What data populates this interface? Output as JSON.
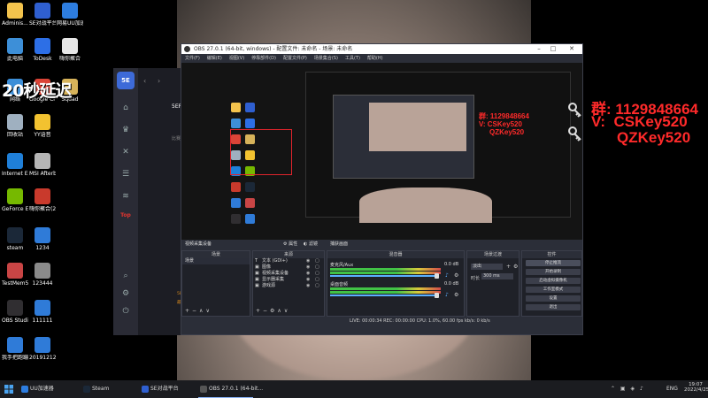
{
  "desktop_icons": [
    {
      "label": "Adminis...",
      "color": "#f3c34d"
    },
    {
      "label": "SE对战平台",
      "color": "#2f5fd0"
    },
    {
      "label": "网易UU加速器",
      "color": "#2d7de0"
    },
    {
      "label": "此电脑",
      "color": "#3d8fd8"
    },
    {
      "label": "ToDesk",
      "color": "#2d6fe6"
    },
    {
      "label": "嗨你聚合",
      "color": "#e7e7e7"
    },
    {
      "label": "网络",
      "color": "#3d8fd8"
    },
    {
      "label": "Google Chrome",
      "color": "#db4437"
    },
    {
      "label": "Squad",
      "color": "#d7b35a"
    },
    {
      "label": "回收站",
      "color": "#9fb0c0"
    },
    {
      "label": "YY语音",
      "color": "#f2c230"
    },
    {
      "label": "Internet Explorer",
      "color": "#1f7fd8"
    },
    {
      "label": "MSI Afterburner",
      "color": "#b5b5b5"
    },
    {
      "label": "GeForce Experience",
      "color": "#76b900"
    },
    {
      "label": "嗨你聚合(2)",
      "color": "#c93a2c"
    },
    {
      "label": "steam",
      "color": "#1b2838"
    },
    {
      "label": "1234",
      "color": "#2f7bd8"
    },
    {
      "label": "TestMem5",
      "color": "#c94545"
    },
    {
      "label": "123444",
      "color": "#8a8a8a"
    },
    {
      "label": "OBS Studio",
      "color": "#302e31"
    },
    {
      "label": "111111",
      "color": "#2f7bd8"
    },
    {
      "label": "我手把跑蹦得主播",
      "color": "#2f7bd8"
    },
    {
      "label": "20191212...",
      "color": "#2f7bd8"
    }
  ],
  "launcher": {
    "title": "5EPL精英赛",
    "registered": "比赛时间: 2022",
    "rank_header": "排名",
    "ranks": [
      "NO.1",
      "NO.2",
      "NO.3",
      "NO.4",
      "NO.5",
      "NO.6",
      "NO.7"
    ],
    "footer1": "5EPlay平台Noi",
    "footer2": "最佳服务器为"
  },
  "obs": {
    "title": "OBS 27.0.1 (64-bit, windows) - 配置文件: 未命名 - 场景: 未命名",
    "menu": [
      "文件(F)",
      "编辑(E)",
      "视图(V)",
      "停靠部件(D)",
      "配置文件(P)",
      "场景集合(S)",
      "工具(T)",
      "帮助(H)"
    ],
    "scene_bar": {
      "label": "视频采集设备",
      "properties": "属性",
      "filters": "滤镜",
      "webcam_device": "捕获画面"
    },
    "panels": {
      "scenes": {
        "header": "场景",
        "items": [
          "场景"
        ]
      },
      "sources": {
        "header": "来源",
        "items": [
          "文本 (GDI+)",
          "图像",
          "视频采集设备",
          "显示器采集",
          "游戏源"
        ]
      },
      "mixer": {
        "header": "混音器",
        "tracks": [
          {
            "name": "麦克风/Aux",
            "db": "0.0 dB"
          },
          {
            "name": "桌面音频",
            "db": "0.0 dB"
          }
        ]
      },
      "transitions": {
        "header": "场景过渡",
        "type": "淡出",
        "duration_label": "时长",
        "duration_value": "300 ms"
      },
      "controls": {
        "header": "控件",
        "buttons": [
          "停止推流",
          "开始录制",
          "启动虚拟摄像机",
          "工作室模式",
          "设置",
          "退出"
        ]
      }
    },
    "status": "LIVE: 00:00:34    REC: 00:00:00    CPU: 1.0%, 60.00 fps    kb/s: 0 kb/s"
  },
  "overlay": {
    "timer": "20秒延迟",
    "qq_group": "群: 1129848664",
    "v_line1": "V:  CSKey520",
    "v_line2": "QZKey520",
    "mini_group": "群: 1129848664",
    "mini_v1": "V: CSKey520",
    "mini_v2": "QZKey520"
  },
  "taskbar": {
    "items": [
      {
        "label": "UU加速器",
        "color": "#2d7de0"
      },
      {
        "label": "Steam",
        "color": "#1b2838"
      },
      {
        "label": "SE对战平台",
        "color": "#2f5fd0"
      },
      {
        "label": "OBS 27.0.1 (64-bit...",
        "color": "#555"
      }
    ],
    "ime": "ENG",
    "time": "19:07",
    "date": "2022/4/25"
  }
}
